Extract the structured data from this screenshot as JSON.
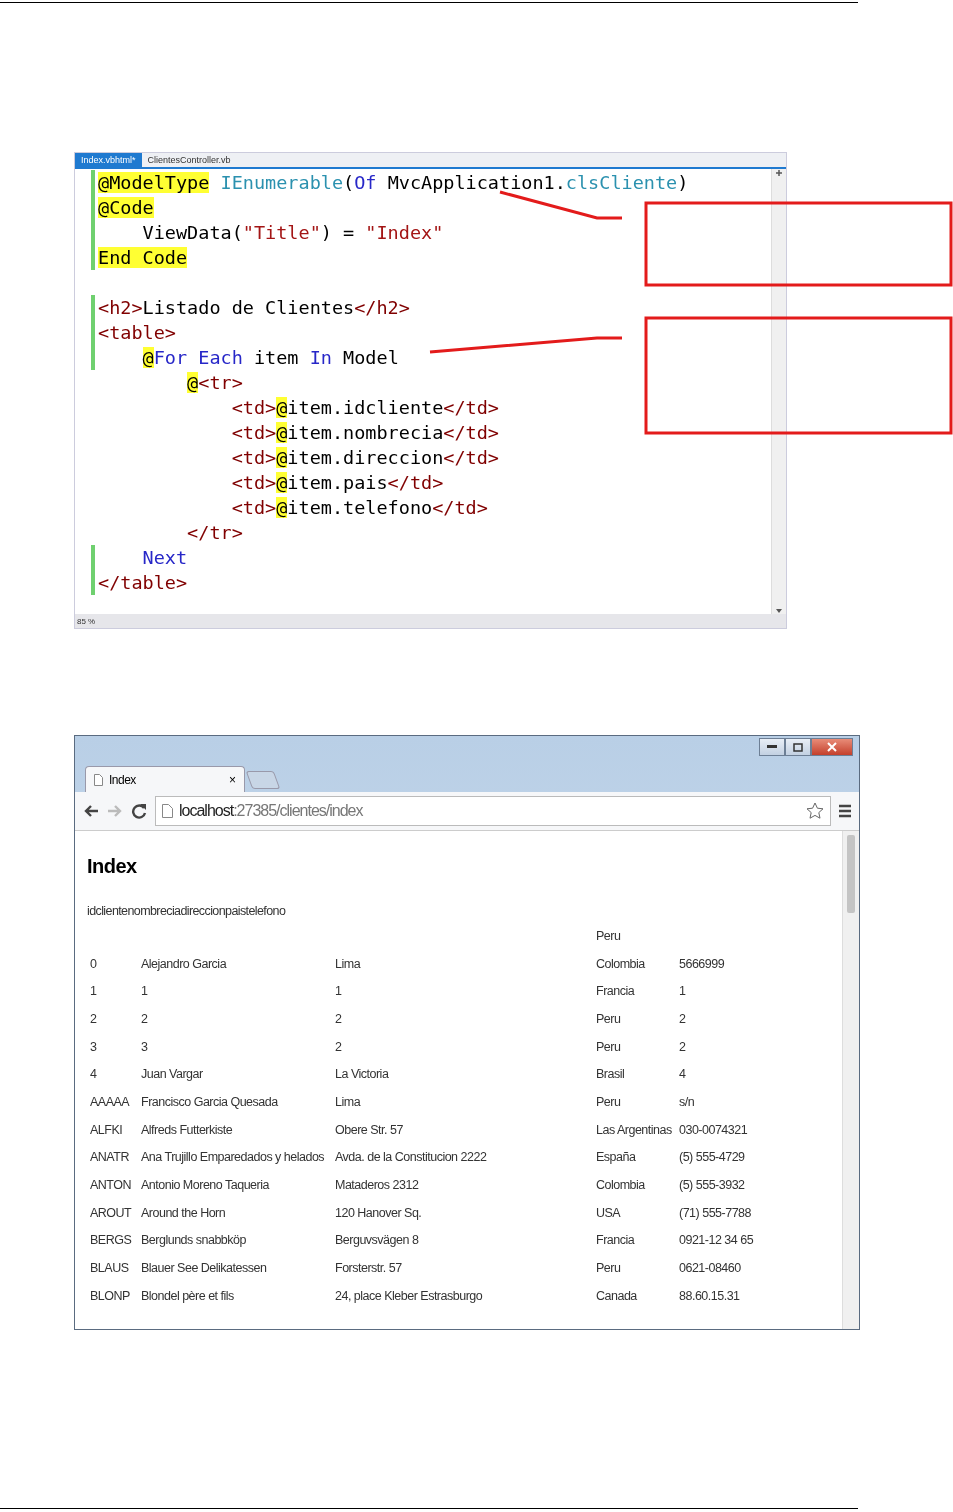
{
  "editor": {
    "tabs": [
      {
        "label": "Index.vbhtml*",
        "selected": true
      },
      {
        "label": "ClientesController.vb",
        "selected": false
      }
    ],
    "lines": [
      {
        "changed": true,
        "segments": [
          {
            "kind": "razor",
            "text": "@ModelType"
          },
          {
            "kind": "type",
            "text": " IEnumerable"
          },
          {
            "kind": "plain",
            "text": "("
          },
          {
            "kind": "keyword",
            "text": "Of"
          },
          {
            "kind": "plain",
            "text": " MvcApplication1."
          },
          {
            "kind": "type",
            "text": "clsCliente"
          },
          {
            "kind": "plain",
            "text": ")"
          }
        ]
      },
      {
        "changed": true,
        "segments": [
          {
            "kind": "razor",
            "text": "@Code"
          }
        ]
      },
      {
        "changed": true,
        "segments": [
          {
            "kind": "plain",
            "text": "    ViewData("
          },
          {
            "kind": "string",
            "text": "\"Title\""
          },
          {
            "kind": "plain",
            "text": ") = "
          },
          {
            "kind": "string",
            "text": "\"Index\""
          }
        ]
      },
      {
        "changed": true,
        "segments": [
          {
            "kind": "razor",
            "text": "End Code"
          }
        ]
      },
      {
        "changed": false
      },
      {
        "changed": true,
        "segments": [
          {
            "kind": "tag",
            "text": "<h2>"
          },
          {
            "kind": "plain",
            "text": "Listado de Clientes"
          },
          {
            "kind": "tag",
            "text": "</h2>"
          }
        ]
      },
      {
        "changed": true,
        "segments": [
          {
            "kind": "tag",
            "text": "<table>"
          }
        ]
      },
      {
        "changed": true,
        "segments": [
          {
            "kind": "razor",
            "text": "    @"
          },
          {
            "kind": "keyword",
            "text": "For Each"
          },
          {
            "kind": "plain",
            "text": " item "
          },
          {
            "kind": "keyword",
            "text": "In"
          },
          {
            "kind": "plain",
            "text": " Model"
          }
        ]
      },
      {
        "changed": false,
        "segments": [
          {
            "kind": "razor",
            "text": "        @"
          },
          {
            "kind": "tag",
            "text": "<tr>"
          }
        ]
      },
      {
        "changed": false,
        "segments": [
          {
            "kind": "tag",
            "text": "            <td>"
          },
          {
            "kind": "razor",
            "text": "@"
          },
          {
            "kind": "plain",
            "text": "item.idcliente"
          },
          {
            "kind": "tag",
            "text": "</td>"
          }
        ]
      },
      {
        "changed": false,
        "segments": [
          {
            "kind": "tag",
            "text": "            <td>"
          },
          {
            "kind": "razor",
            "text": "@"
          },
          {
            "kind": "plain",
            "text": "item.nombrecia"
          },
          {
            "kind": "tag",
            "text": "</td>"
          }
        ]
      },
      {
        "changed": false,
        "segments": [
          {
            "kind": "tag",
            "text": "            <td>"
          },
          {
            "kind": "razor",
            "text": "@"
          },
          {
            "kind": "plain",
            "text": "item.direccion"
          },
          {
            "kind": "tag",
            "text": "</td>"
          }
        ]
      },
      {
        "changed": false,
        "segments": [
          {
            "kind": "tag",
            "text": "            <td>"
          },
          {
            "kind": "razor",
            "text": "@"
          },
          {
            "kind": "plain",
            "text": "item.pais"
          },
          {
            "kind": "tag",
            "text": "</td>"
          }
        ]
      },
      {
        "changed": false,
        "segments": [
          {
            "kind": "tag",
            "text": "            <td>"
          },
          {
            "kind": "razor",
            "text": "@"
          },
          {
            "kind": "plain",
            "text": "item.telefono"
          },
          {
            "kind": "tag",
            "text": "</td>"
          }
        ]
      },
      {
        "changed": false,
        "segments": [
          {
            "kind": "tag",
            "text": "        </tr>"
          }
        ]
      },
      {
        "changed": true,
        "segments": [
          {
            "kind": "keyword",
            "text": "    Next"
          }
        ]
      },
      {
        "changed": true,
        "segments": [
          {
            "kind": "tag",
            "text": "</table>"
          }
        ]
      }
    ],
    "zoom": "85 %"
  },
  "browser": {
    "tab": {
      "title": "Index",
      "close": "×"
    },
    "address": {
      "host": "localhost",
      "path": ":27385/clientes/index"
    },
    "heading": "Index",
    "header_text": "idclientenombreciadireccionpaistelefono",
    "rows": [
      {
        "column_4": "Peru"
      },
      {
        "column_1": "0",
        "column_2": "Alejandro Garcia",
        "column_3": "Lima",
        "column_4": "Colombia",
        "column_5": "5666999"
      },
      {
        "column_1": "1",
        "column_2": "1",
        "column_3": "1",
        "column_4": "Francia",
        "column_5": "1"
      },
      {
        "column_1": "2",
        "column_2": "2",
        "column_3": "2",
        "column_4": "Peru",
        "column_5": "2"
      },
      {
        "column_1": "3",
        "column_2": "3",
        "column_3": "2",
        "column_4": "Peru",
        "column_5": "2"
      },
      {
        "column_1": "4",
        "column_2": "Juan Vargar",
        "column_3": "La Victoria",
        "column_4": "Brasil",
        "column_5": "4"
      },
      {
        "column_1": "AAAAA",
        "column_2": "Francisco Garcia Quesada",
        "column_3": "Lima",
        "column_4": "Peru",
        "column_5": "s/n"
      },
      {
        "column_1": "ALFKI",
        "column_2": "Alfreds Futterkiste",
        "column_3": "Obere Str. 57",
        "column_4": "Las Argentinas",
        "column_5": "030-0074321"
      },
      {
        "column_1": "ANATR",
        "column_2": "Ana Trujillo Emparedados y helados",
        "column_3": "Avda. de la Constitucion 2222",
        "column_4": "España",
        "column_5": "(5) 555-4729"
      },
      {
        "column_1": "ANTON",
        "column_2": "Antonio Moreno Taqueria",
        "column_3": "Mataderos 2312",
        "column_4": "Colombia",
        "column_5": "(5) 555-3932"
      },
      {
        "column_1": "AROUT",
        "column_2": "Around the Horn",
        "column_3": "120 Hanover Sq.",
        "column_4": "USA",
        "column_5": "(71) 555-7788"
      },
      {
        "column_1": "BERGS",
        "column_2": "Berglunds snabbköp",
        "column_3": "Berguvsvägen 8",
        "column_4": "Francia",
        "column_5": "0921-12 34 65"
      },
      {
        "column_1": "BLAUS",
        "column_2": "Blauer See Delikatessen",
        "column_3": "Forsterstr. 57",
        "column_4": "Peru",
        "column_5": "0621-08460"
      },
      {
        "column_1": "BLONP",
        "column_2": "Blondel père et fils",
        "column_3": "24, place Kleber Estrasburgo",
        "column_4": "Canada",
        "column_5": "88.60.15.31"
      }
    ]
  }
}
